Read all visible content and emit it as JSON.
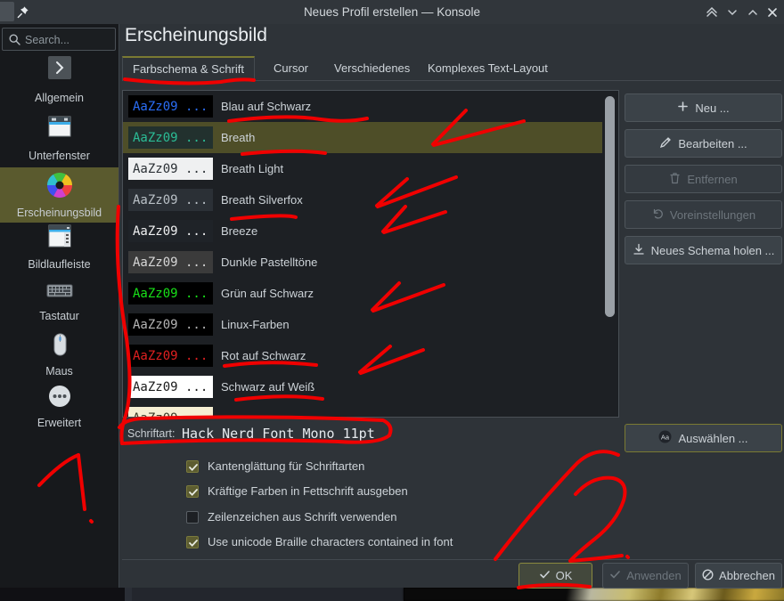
{
  "window": {
    "title": "Neues Profil erstellen — Konsole",
    "pin_icon": "pin-icon",
    "controls": [
      {
        "name": "keep-above-icon",
        "glyph": "double-chevron-up"
      },
      {
        "name": "minimize-icon",
        "glyph": "chevron-down"
      },
      {
        "name": "maximize-icon",
        "glyph": "chevron-up"
      },
      {
        "name": "close-icon",
        "glyph": "close-x"
      }
    ]
  },
  "search": {
    "placeholder": "Search...",
    "value": "",
    "icon": "search-icon"
  },
  "page_title": "Erscheinungsbild",
  "sidebar": {
    "items": [
      {
        "label": "Allgemein",
        "icon": "chevron-right-icon",
        "selected": false
      },
      {
        "label": "Unterfenster",
        "icon": "window-tabs-icon",
        "selected": false
      },
      {
        "label": "Erscheinungsbild",
        "icon": "color-wheel-icon",
        "selected": true
      },
      {
        "label": "Bildlaufleiste",
        "icon": "scrollbar-icon",
        "selected": false
      },
      {
        "label": "Tastatur",
        "icon": "keyboard-icon",
        "selected": false
      },
      {
        "label": "Maus",
        "icon": "mouse-icon",
        "selected": false
      },
      {
        "label": "Erweitert",
        "icon": "ellipsis-circle-icon",
        "selected": false
      }
    ]
  },
  "tabs": [
    {
      "label": "Farbschema & Schrift",
      "active": true
    },
    {
      "label": "Cursor",
      "active": false
    },
    {
      "label": "Verschiedenes",
      "active": false
    },
    {
      "label": "Komplexes Text-Layout",
      "active": false
    }
  ],
  "scheme_list": {
    "sample_text": "AaZz09 ...",
    "rows": [
      {
        "label": "Blau auf Schwarz",
        "bg": "#000000",
        "fg": "#2a6df5",
        "selected": false
      },
      {
        "label": "Breath",
        "bg": "#22312e",
        "fg": "#2bbd96",
        "selected": true
      },
      {
        "label": "Breath Light",
        "bg": "#eff0f1",
        "fg": "#2a2f34",
        "selected": false
      },
      {
        "label": "Breath Silverfox",
        "bg": "#2b3036",
        "fg": "#b9c0c6",
        "selected": false
      },
      {
        "label": "Breeze",
        "bg": "#1f2328",
        "fg": "#eff0f1",
        "selected": false
      },
      {
        "label": "Dunkle Pastelltöne",
        "bg": "#3b3b3b",
        "fg": "#d6d6d6",
        "selected": false
      },
      {
        "label": "Grün auf Schwarz",
        "bg": "#000000",
        "fg": "#18e018",
        "selected": false
      },
      {
        "label": "Linux-Farben",
        "bg": "#000000",
        "fg": "#b4b4b4",
        "selected": false
      },
      {
        "label": "Rot auf Schwarz",
        "bg": "#000000",
        "fg": "#e02020",
        "selected": false
      },
      {
        "label": "Schwarz auf Weiß",
        "bg": "#ffffff",
        "fg": "#1a1a1a",
        "selected": false
      },
      {
        "label": "",
        "bg": "#f5eed2",
        "fg": "#3a3a28",
        "selected": false
      }
    ]
  },
  "scheme_buttons": [
    {
      "label": "Neu ...",
      "icon": "plus-icon",
      "enabled": true,
      "focused": false
    },
    {
      "label": "Bearbeiten ...",
      "icon": "pencil-icon",
      "enabled": true,
      "focused": false
    },
    {
      "label": "Entfernen",
      "icon": "trash-icon",
      "enabled": false,
      "focused": false
    },
    {
      "label": "Voreinstellungen",
      "icon": "undo-icon",
      "enabled": false,
      "focused": false
    },
    {
      "label": "Neues Schema holen ...",
      "icon": "download-icon",
      "enabled": true,
      "focused": false
    }
  ],
  "font": {
    "label": "Schriftart:",
    "value": "Hack Nerd Font Mono 11pt",
    "select_button": {
      "label": "Auswählen ...",
      "icon": "font-aa-icon",
      "focused": true
    }
  },
  "checkboxes": [
    {
      "label": "Kantenglättung für Schriftarten",
      "checked": true
    },
    {
      "label": "Kräftige Farben in Fettschrift ausgeben",
      "checked": true
    },
    {
      "label": "Zeilenzeichen aus Schrift verwenden",
      "checked": false
    },
    {
      "label": "Use unicode Braille characters contained in font",
      "checked": true
    }
  ],
  "footer_buttons": [
    {
      "label": "OK",
      "icon": "check-icon",
      "enabled": true,
      "focused": true
    },
    {
      "label": "Anwenden",
      "icon": "check-icon",
      "enabled": false,
      "focused": false
    },
    {
      "label": "Abbrechen",
      "icon": "cancel-icon",
      "enabled": true,
      "focused": false
    }
  ],
  "colors": {
    "titlebar": "#31363b",
    "dialog_bg": "#2e3338",
    "sidebar_bg": "#17191c",
    "accent_olive": "#5a5a2e",
    "annotation_red": "#f00000"
  },
  "annotations": {
    "marker_1": "1.",
    "marker_2": "2."
  }
}
